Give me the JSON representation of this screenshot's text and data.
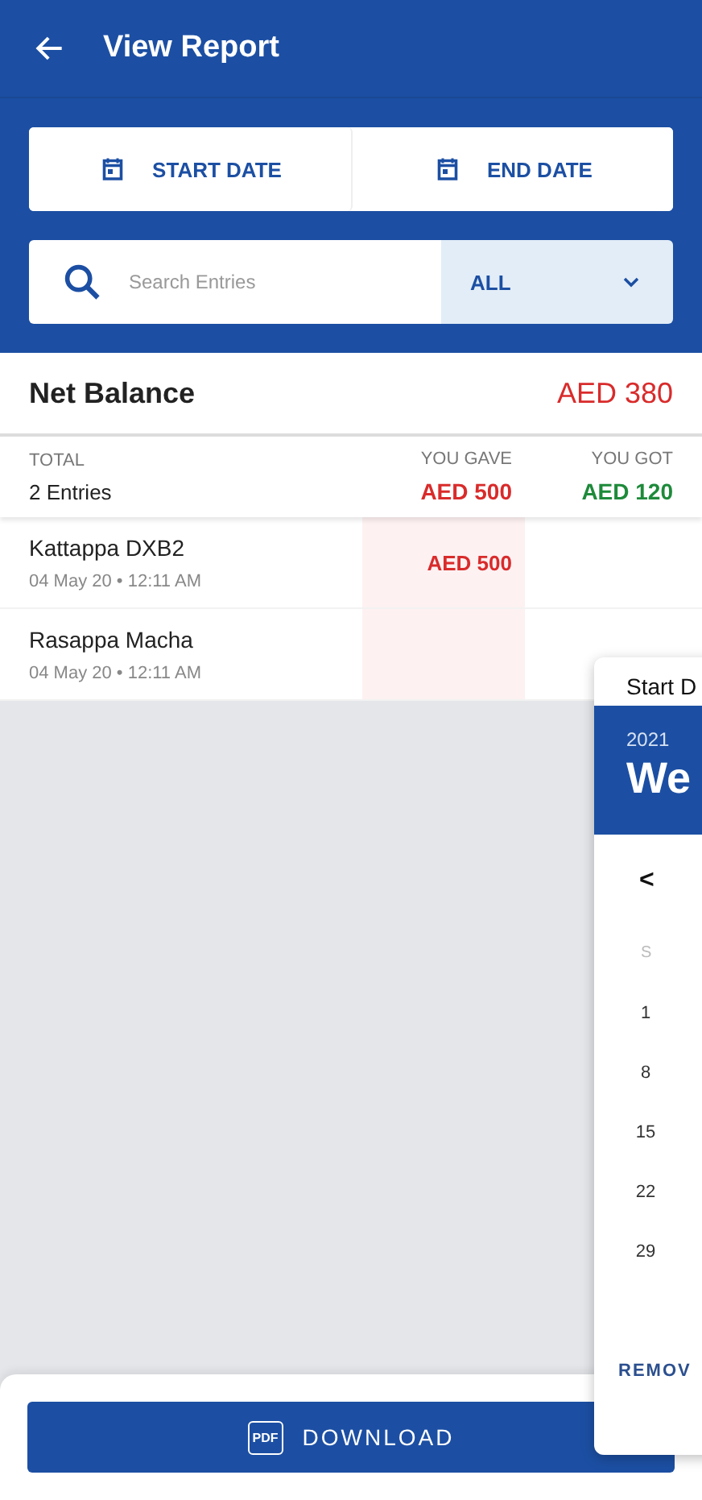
{
  "app_bar": {
    "title": "View Report"
  },
  "date_buttons": [
    {
      "label": "START DATE"
    },
    {
      "label": "END DATE"
    }
  ],
  "search": {
    "placeholder": "Search Entries",
    "filter": "ALL"
  },
  "net_balance": {
    "label": "Net Balance",
    "amount": "AED 380"
  },
  "totals": {
    "label": "TOTAL",
    "entries": "2 Entries",
    "gave_label": "YOU GAVE",
    "gave": "AED 500",
    "got_label": "YOU GOT",
    "got": "AED 120"
  },
  "entries": [
    {
      "name": "Kattappa DXB2",
      "date": "04 May 20 • 12:11 AM",
      "gave": "AED 500"
    },
    {
      "name": "Rasappa Macha",
      "date": "04 May 20 • 12:11 AM"
    }
  ],
  "date_picker": {
    "title": "Start D",
    "year": "2021",
    "date": "We",
    "prev": "<",
    "weekday": "S",
    "days": [
      "1",
      "8",
      "15",
      "22",
      "29"
    ],
    "remove": "REMOV"
  },
  "download": {
    "badge": "PDF",
    "label": "DOWNLOAD"
  }
}
